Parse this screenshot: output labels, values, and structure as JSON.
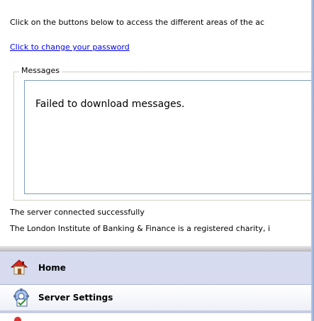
{
  "content": {
    "intro_text": "Click on the buttons below to access the different areas of the ac",
    "password_link": "Click to change your password",
    "messages": {
      "legend": "Messages",
      "text": "Failed to download messages."
    },
    "status_text": "The server connected successfully",
    "charity_text": "The London Institute of Banking & Finance is a registered charity, i"
  },
  "nav": {
    "items": [
      {
        "label": "Home",
        "icon": "home-icon",
        "selected": true
      },
      {
        "label": "Server Settings",
        "icon": "server-settings-icon",
        "selected": false
      }
    ]
  },
  "colors": {
    "link": "#0000ee",
    "selected_nav_bg": "#d6dbef",
    "accent_strip": "#8fa6d3"
  }
}
